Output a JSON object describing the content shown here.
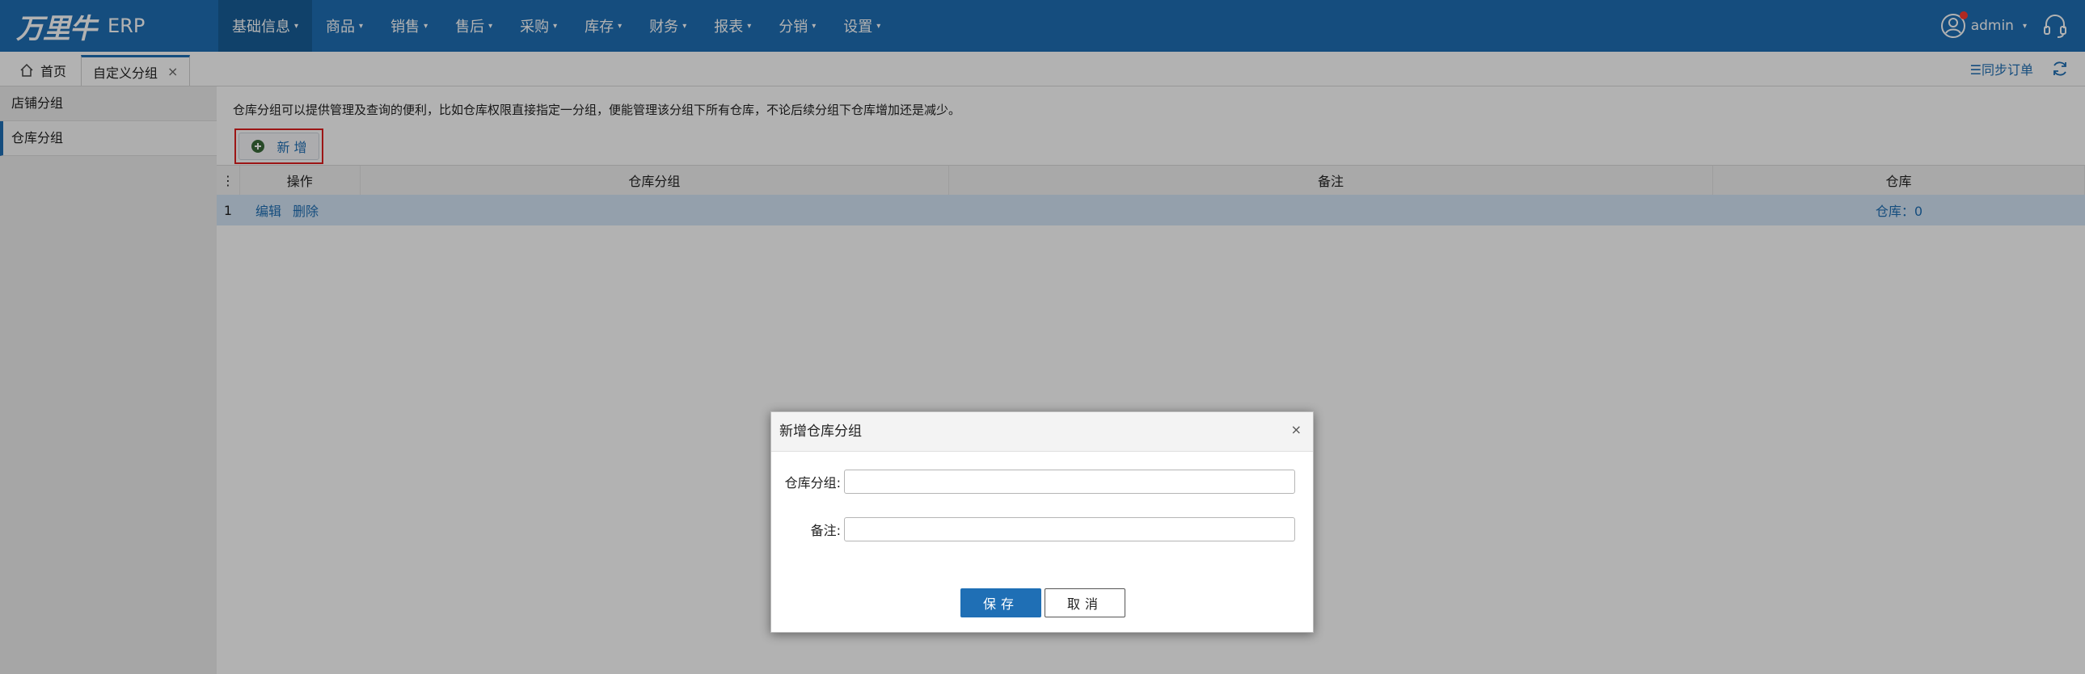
{
  "app": {
    "logo": "万里牛",
    "product": "ERP"
  },
  "nav": {
    "items": [
      {
        "label": "基础信息"
      },
      {
        "label": "商品"
      },
      {
        "label": "销售"
      },
      {
        "label": "售后"
      },
      {
        "label": "采购"
      },
      {
        "label": "库存"
      },
      {
        "label": "财务"
      },
      {
        "label": "报表"
      },
      {
        "label": "分销"
      },
      {
        "label": "设置"
      }
    ],
    "active_index": 0,
    "user": "admin"
  },
  "tabs": {
    "home": "首页",
    "active": "自定义分组",
    "close": "×",
    "sync_orders": "☰同步订单"
  },
  "sidebar": {
    "items": [
      {
        "label": "店铺分组"
      },
      {
        "label": "仓库分组"
      }
    ],
    "active_index": 1
  },
  "main": {
    "description": "仓库分组可以提供管理及查询的便利，比如仓库权限直接指定一分组，便能管理该分组下所有仓库，不论后续分组下仓库增加还是减少。",
    "add_button": "新 增",
    "grid": {
      "headers": [
        "操作",
        "仓库分组",
        "备注",
        "仓库"
      ],
      "rows": [
        {
          "num": "1",
          "edit": "编辑",
          "delete": "删除",
          "group": "",
          "remark": "",
          "warehouse": "仓库：0"
        }
      ]
    }
  },
  "dialog": {
    "title": "新增仓库分组",
    "close": "×",
    "group_label": "仓库分组:",
    "group_value": "",
    "remark_label": "备注:",
    "remark_value": "",
    "save": "保存",
    "cancel": "取消"
  },
  "colors": {
    "primary": "#1f6fb5",
    "highlight_border": "#e02020",
    "selected_row": "#d4e6f6"
  }
}
